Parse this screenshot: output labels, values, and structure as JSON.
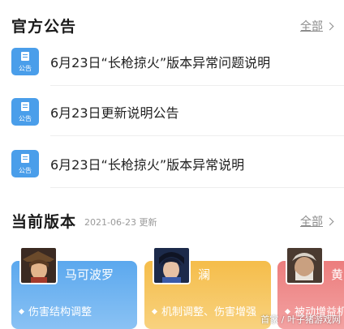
{
  "announcements": {
    "title": "官方公告",
    "more_label": "全部",
    "icon_tag": "公告",
    "items": [
      {
        "text": "6月23日“长枪掠火”版本异常问题说明"
      },
      {
        "text": "6月23日更新说明公告"
      },
      {
        "text": "6月23日“长枪掠火”版本异常说明"
      }
    ]
  },
  "version": {
    "title": "当前版本",
    "date": "2021-06-23 更新",
    "more_label": "全部",
    "heroes": [
      {
        "name": "马可波罗",
        "change": "伤害结构调整",
        "color": "#5ba8ee"
      },
      {
        "name": "澜",
        "change": "机制调整、伤害增强",
        "color": "#f5bd4a"
      },
      {
        "name": "黄",
        "change": "被动增益机",
        "color": "#ec7d7d"
      }
    ]
  },
  "watermark": "首家 / 叶子猪游戏网"
}
